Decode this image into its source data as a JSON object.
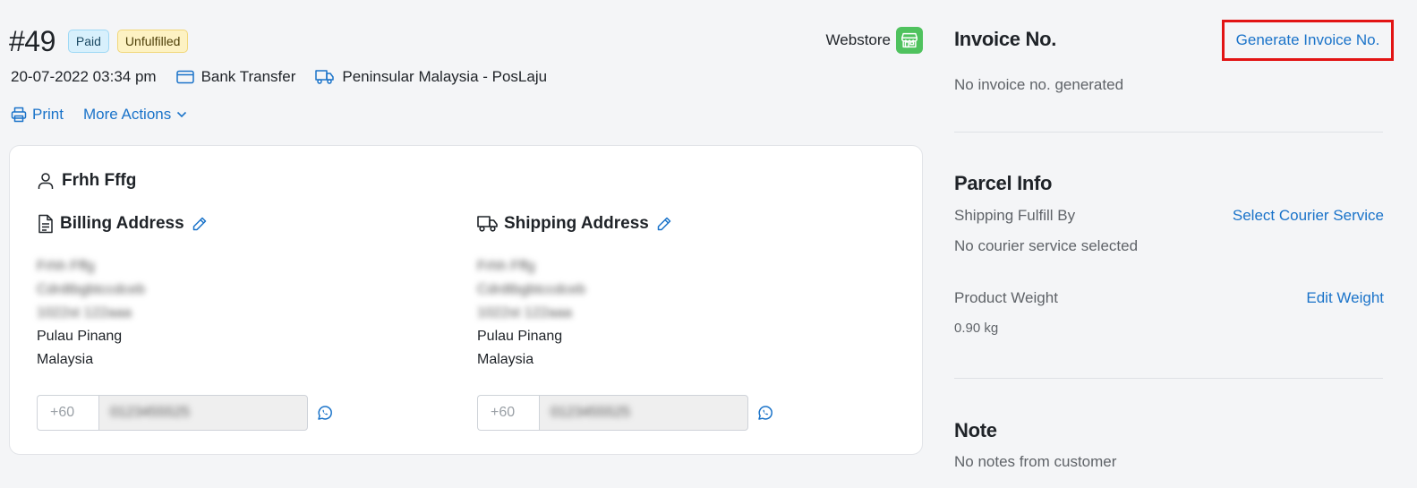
{
  "order": {
    "number": "#49",
    "badges": {
      "paid": "Paid",
      "unfulfilled": "Unfulfilled"
    },
    "channel": "Webstore",
    "date": "20-07-2022 03:34 pm",
    "payment_method": "Bank Transfer",
    "shipping_method": "Peninsular Malaysia - PosLaju",
    "actions": {
      "print": "Print",
      "more_actions": "More Actions"
    }
  },
  "customer": {
    "name": "Frhh Fffg",
    "billing": {
      "title": "Billing Address",
      "lines_blurred": [
        "Frhh Fffg",
        "Cdrdtbgbtccdceb",
        "1022st 122aaa"
      ],
      "city": "Pulau Pinang",
      "country": "Malaysia",
      "phone_code": "+60",
      "phone_number": "0123455525"
    },
    "shipping": {
      "title": "Shipping Address",
      "lines_blurred": [
        "Frhh Fffg",
        "Cdrdtbgbtccdceb",
        "1022st 122aaa"
      ],
      "city": "Pulau Pinang",
      "country": "Malaysia",
      "phone_code": "+60",
      "phone_number": "0123455525"
    }
  },
  "invoice": {
    "title": "Invoice No.",
    "generate_link": "Generate Invoice No.",
    "status": "No invoice no. generated"
  },
  "parcel": {
    "title": "Parcel Info",
    "fulfill_label": "Shipping Fulfill By",
    "select_courier_link": "Select Courier Service",
    "courier_status": "No courier service selected",
    "weight_label": "Product Weight",
    "edit_weight_link": "Edit Weight",
    "weight_value": "0.90 kg"
  },
  "note": {
    "title": "Note",
    "status": "No notes from customer"
  },
  "colors": {
    "accent_link": "#1a73c9",
    "highlight_box": "#e21414",
    "webstore_green": "#4fc25e"
  }
}
